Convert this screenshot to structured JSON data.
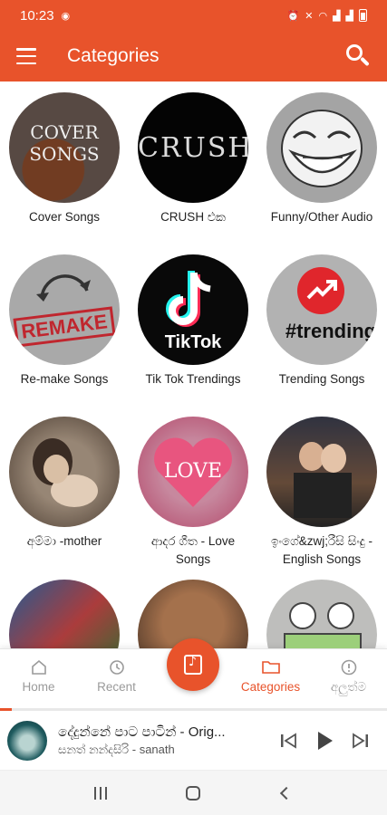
{
  "status_bar": {
    "time": "10:23",
    "left_icons": [
      "app-notification-icon"
    ],
    "right_icons": [
      "alarm-icon",
      "mute-icon",
      "wifi-icon",
      "signal-icon",
      "signal-icon",
      "battery-icon"
    ]
  },
  "app_bar": {
    "title": "Categories",
    "color": "#e8532b",
    "menu_icon": "hamburger-icon",
    "search_icon": "search-icon"
  },
  "categories": [
    {
      "label": "Cover Songs",
      "art_text": "COVER\nSONGS"
    },
    {
      "label": "CRUSH එක",
      "art_text": "CRUSH"
    },
    {
      "label": "Funny/Other Audio",
      "art_text": ""
    },
    {
      "label": "Re-make Songs",
      "art_text": "REMAKE"
    },
    {
      "label": "Tik Tok Trendings",
      "art_text": "TikTok"
    },
    {
      "label": "Trending Songs",
      "art_text": "#trending"
    },
    {
      "label": "අම්මා -mother",
      "art_text": ""
    },
    {
      "label": "ආදර ගීත - Love Songs",
      "art_text": "LOVE"
    },
    {
      "label": "ඉංගේ&zwj;රීසි සිංදු - English Songs",
      "art_text": ""
    },
    {
      "label": "",
      "art_text": ""
    },
    {
      "label": "",
      "art_text": ""
    },
    {
      "label": "",
      "art_text": ""
    }
  ],
  "bottom_nav": {
    "items": [
      {
        "label": "Home",
        "icon": "home-icon",
        "active": false
      },
      {
        "label": "Recent",
        "icon": "history-icon",
        "active": false
      },
      {
        "label": "Categories",
        "icon": "folder-icon",
        "active": true
      },
      {
        "label": "අලුත්ම",
        "icon": "new-icon",
        "active": false
      }
    ],
    "center_icon": "music-library-icon",
    "active_color": "#e8532b"
  },
  "player": {
    "song": "දේදුන්නේ පාට පාටින් - Orig...",
    "artist": "සනත් නන්දසිරි - sanath",
    "progress": 0.03
  },
  "system_nav": [
    "recents-icon",
    "home-icon",
    "back-icon"
  ]
}
